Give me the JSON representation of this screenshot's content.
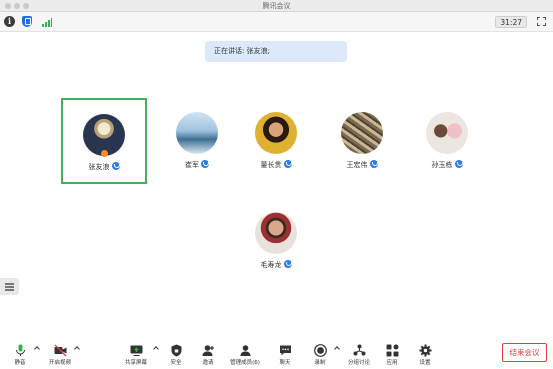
{
  "window": {
    "title": "腾讯会议"
  },
  "topbar": {
    "timer": "31:27"
  },
  "speaking_banner": "正在讲话: 张友浪;",
  "participants": [
    {
      "name": "张友浪",
      "active": true
    },
    {
      "name": "崔军",
      "active": false
    },
    {
      "name": "董长贵",
      "active": false
    },
    {
      "name": "王宏伟",
      "active": false
    },
    {
      "name": "孙玉栋",
      "active": false
    },
    {
      "name": "毛寿龙",
      "active": false
    }
  ],
  "toolbar": {
    "mute": "静音",
    "video": "开启视频",
    "share": "共享屏幕",
    "security": "安全",
    "invite": "邀请",
    "members": "管理成员(6)",
    "chat": "聊天",
    "record": "录制",
    "breakout": "分组讨论",
    "apps": "应用",
    "settings": "设置",
    "end": "结束会议"
  },
  "colors": {
    "accent": "#2d7ce8",
    "active_border": "#3fb25a",
    "end": "#e04040",
    "banner": "#dce9fb"
  }
}
